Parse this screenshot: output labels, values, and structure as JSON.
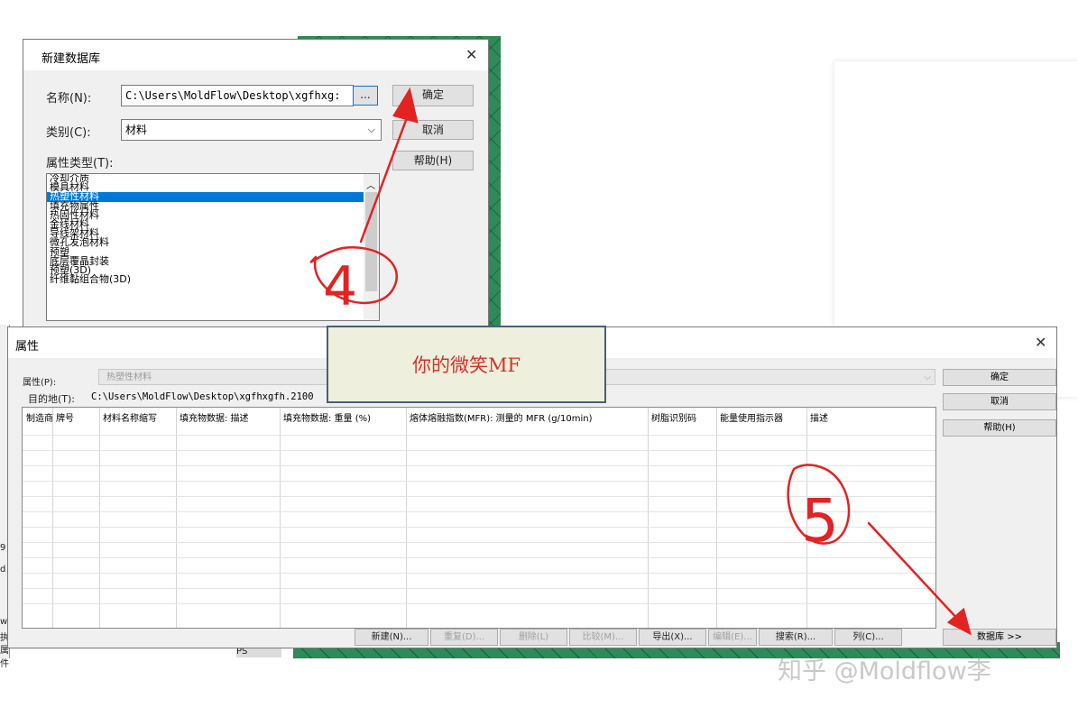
{
  "new_db_dialog": {
    "title": "新建数据库",
    "name_label": "名称(N):",
    "name_value": "C:\\Users\\MoldFlow\\Desktop\\xgfhxg:",
    "browse_label": "...",
    "ok": "确定",
    "cancel": "取消",
    "help": "帮助(H)",
    "category_label": "类别(C):",
    "category_value": "材料",
    "property_type_label": "属性类型(T):",
    "property_types": [
      "冷却介质",
      "模具材料",
      "热塑性材料",
      "填充物属性",
      "热固性材料",
      "金线材料",
      "导线架材料",
      "微孔发泡材料",
      "预塑",
      "底层覆晶封装",
      "预塑(3D)",
      "纤维黏组合物(3D)"
    ],
    "selected_index": 2
  },
  "props_dialog": {
    "title": "属性",
    "prop_label": "属性(P):",
    "prop_value": "热塑性材料",
    "dest_label": "目的地(T):",
    "dest_value": "C:\\Users\\MoldFlow\\Desktop\\xgfhxgfh.2100",
    "ok": "确定",
    "cancel": "取消",
    "help": "帮助(H)",
    "columns": [
      "制造商",
      "牌号",
      "材料名称缩写",
      "填充物数据: 描述",
      "填充物数据: 重量 (%)",
      "熔体熔融指数(MFR): 测量的 MFR (g/10min)",
      "树脂识别码",
      "能量使用指示器",
      "描述"
    ],
    "bottom_buttons": [
      {
        "label": "新建(N)...",
        "enabled": true
      },
      {
        "label": "重复(D)...",
        "enabled": false
      },
      {
        "label": "删除(L)",
        "enabled": false
      },
      {
        "label": "比较(M)...",
        "enabled": false
      },
      {
        "label": "导出(X)...",
        "enabled": true
      },
      {
        "label": "编辑(E)...",
        "enabled": false
      },
      {
        "label": "搜索(R)...",
        "enabled": true
      },
      {
        "label": "列(C)...",
        "enabled": true
      }
    ],
    "database_button": "数据库 >>"
  },
  "overlay_text": "你的微笑MF",
  "watermark": "知乎 @Moldflow李",
  "annotations": {
    "step4": "4",
    "step5": "5",
    "color": "#e32222"
  },
  "left_edge_fragments": [
    "9",
    "d",
    "w",
    "执",
    "属件"
  ],
  "taskbar_fragment": "PS"
}
